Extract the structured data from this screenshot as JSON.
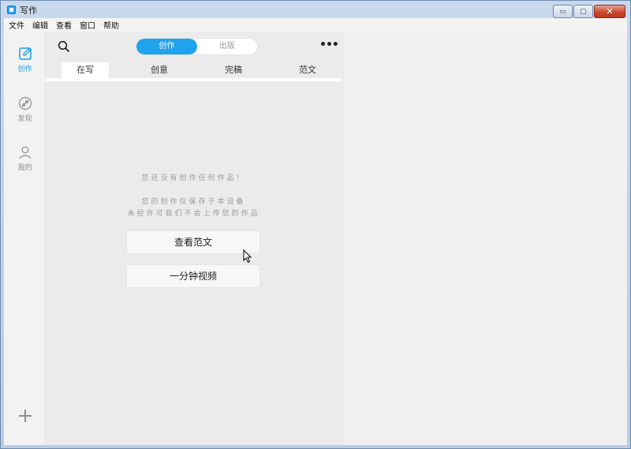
{
  "window": {
    "title": "写作",
    "controls": {
      "minimize": "▭",
      "maximize": "▢",
      "close": "✕"
    }
  },
  "menubar": {
    "items": [
      "文件",
      "编辑",
      "查看",
      "窗口",
      "帮助"
    ]
  },
  "rail": {
    "items": [
      {
        "label": "创作",
        "icon": "edit-icon",
        "active": true
      },
      {
        "label": "发现",
        "icon": "compass-icon",
        "active": false
      },
      {
        "label": "我的",
        "icon": "user-icon",
        "active": false
      }
    ],
    "add_icon": "plus-icon"
  },
  "panel": {
    "segment": {
      "active": "创作",
      "inactive": "出版"
    },
    "more_label": "•••",
    "tabs": [
      {
        "label": "在写",
        "active": true
      },
      {
        "label": "创意",
        "active": false
      },
      {
        "label": "完稿",
        "active": false
      },
      {
        "label": "范文",
        "active": false
      }
    ],
    "empty": {
      "line1": "您还没有创作任何作品！",
      "line2": "您的创作仅保存于本设备",
      "line3": "未经许可我们不会上传您的作品"
    },
    "buttons": {
      "view_samples": "查看范文",
      "one_minute_video": "一分钟视频"
    }
  },
  "colors": {
    "accent": "#1ea3ec",
    "muted_text": "#9a9a9a"
  }
}
